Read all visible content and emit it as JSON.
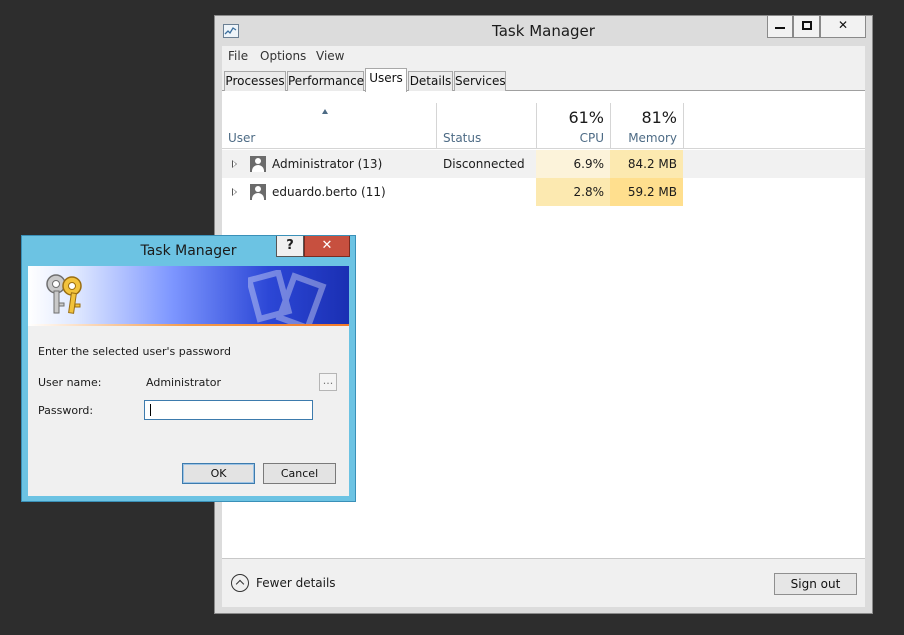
{
  "task_manager": {
    "title": "Task Manager",
    "menu": [
      "File",
      "Options",
      "View"
    ],
    "tabs": [
      "Processes",
      "Performance",
      "Users",
      "Details",
      "Services"
    ],
    "active_tab": "Users",
    "columns": {
      "user": "User",
      "status": "Status",
      "cpu_total": "61%",
      "cpu_label": "CPU",
      "memory_total": "81%",
      "memory_label": "Memory"
    },
    "rows": [
      {
        "user": "Administrator (13)",
        "status": "Disconnected",
        "cpu": "6.9%",
        "memory": "84.2 MB"
      },
      {
        "user": "eduardo.berto (11)",
        "status": "",
        "cpu": "2.8%",
        "memory": "59.2 MB"
      }
    ],
    "footer": {
      "fewer_details": "Fewer details",
      "sign_out": "Sign out"
    }
  },
  "dialog": {
    "title": "Task Manager",
    "prompt": "Enter the selected user's password",
    "username_label": "User name:",
    "username_value": "Administrator",
    "browse_label": "...",
    "password_label": "Password:",
    "password_value": "",
    "ok_label": "OK",
    "cancel_label": "Cancel"
  },
  "colors": {
    "desktop": "#2d2d2d",
    "dialog_frame": "#6cc3e3",
    "close_button": "#c7503f",
    "heat_light": "#fcf3da",
    "heat_medium": "#fce9b0",
    "heat_strong": "#ffdf8e"
  },
  "icons": [
    "task-manager-app-icon",
    "minimize-icon",
    "maximize-icon",
    "close-icon",
    "sort-up-icon",
    "expand-icon",
    "user-icon",
    "chevron-up-circle-icon",
    "help-icon",
    "keys-icon"
  ]
}
